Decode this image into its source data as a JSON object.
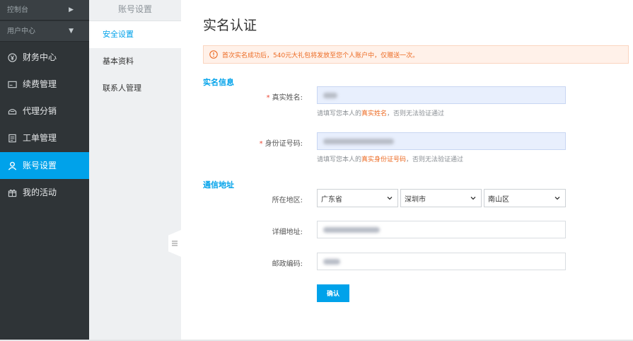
{
  "sidebar": {
    "top_items": [
      {
        "label": "控制台"
      },
      {
        "label": "用户中心"
      }
    ],
    "items": [
      {
        "label": "财务中心",
        "icon": "yen-circle-icon"
      },
      {
        "label": "续费管理",
        "icon": "card-icon"
      },
      {
        "label": "代理分销",
        "icon": "share-icon"
      },
      {
        "label": "工单管理",
        "icon": "document-icon"
      },
      {
        "label": "账号设置",
        "icon": "user-icon",
        "active": true
      },
      {
        "label": "我的活动",
        "icon": "gift-icon"
      }
    ]
  },
  "subnav": {
    "title": "账号设置",
    "items": [
      {
        "label": "安全设置",
        "active": true
      },
      {
        "label": "基本资料"
      },
      {
        "label": "联系人管理"
      }
    ]
  },
  "main": {
    "title": "实名认证",
    "notice": "首次实名成功后，540元大礼包将发放至您个人账户中，仅赠送一次。",
    "section_identity": "实名信息",
    "name_label": "真实姓名:",
    "name_hint_prefix": "请填写您本人的",
    "name_hint_em": "真实姓名",
    "name_hint_suffix": "，否则无法验证通过",
    "id_label": "身份证号码:",
    "id_hint_prefix": "请填写您本人的",
    "id_hint_em": "真实身份证号码",
    "id_hint_suffix": "，否则无法验证通过",
    "section_address": "通信地址",
    "region_label": "所在地区:",
    "province": "广东省",
    "city": "深圳市",
    "district": "南山区",
    "address_label": "详细地址:",
    "postal_label": "邮政编码:",
    "confirm_label": "确认"
  },
  "colors": {
    "accent": "#00a2ea",
    "notice_text": "#ec6b24",
    "required": "#ec4a38",
    "sidebar_bg": "#2f3437"
  }
}
